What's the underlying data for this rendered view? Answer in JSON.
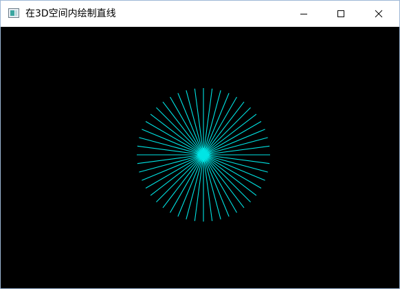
{
  "window": {
    "title": "在3D空间内绘制直线",
    "controls": {
      "minimize_icon": "minimize-icon",
      "maximize_icon": "maximize-icon",
      "close_icon": "close-icon"
    }
  },
  "scene": {
    "background_color": "#000000",
    "line_color": "#00e5e5",
    "line_count": 48
  }
}
